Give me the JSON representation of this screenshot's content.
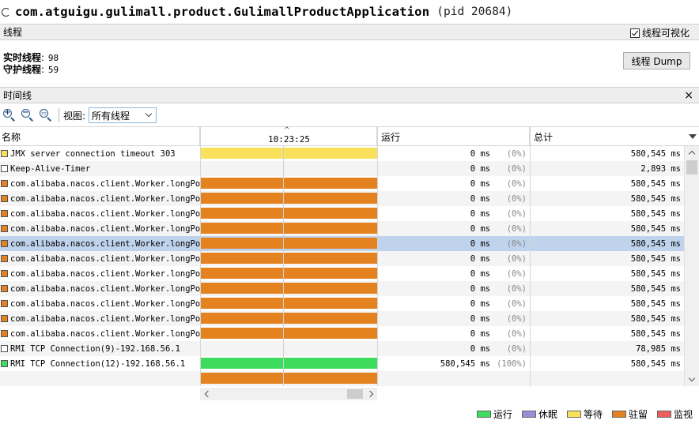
{
  "app": {
    "title": "com.atguigu.gulimall.product.GulimallProductApplication",
    "pid": "(pid 20684)"
  },
  "threads_panel": {
    "header": "线程",
    "visualize_label": "线程可视化",
    "visualize_checked": true,
    "live_label": "实时线程",
    "live_value": "98",
    "daemon_label": "守护线程",
    "daemon_value": "59",
    "dump_button": "线程 Dump"
  },
  "timeline_panel": {
    "header": "时间线",
    "close_symbol": "×",
    "view_label": "视图:",
    "view_selected": "所有线程",
    "zoom_in_symbol": "+",
    "zoom_out_symbol": "−"
  },
  "table": {
    "headers": {
      "name": "名称",
      "time": "10:23:25",
      "run": "运行",
      "total": "总计"
    },
    "rows": [
      {
        "color": "#fae15c",
        "name": "JMX server connection timeout 303",
        "bar": 1.0,
        "run": "0 ms",
        "pct": "(0%)",
        "total": "580,545 ms"
      },
      {
        "color": "#ffffff",
        "name": "Keep-Alive-Timer",
        "bar": 0,
        "run": "0 ms",
        "pct": "(0%)",
        "total": "2,893 ms"
      },
      {
        "color": "#e58220",
        "name": "com.alibaba.nacos.client.Worker.longPolling.fixed-",
        "bar": 1.0,
        "run": "0 ms",
        "pct": "(0%)",
        "total": "580,545 ms"
      },
      {
        "color": "#e58220",
        "name": "com.alibaba.nacos.client.Worker.longPolling.fixed-",
        "bar": 1.0,
        "run": "0 ms",
        "pct": "(0%)",
        "total": "580,545 ms"
      },
      {
        "color": "#e58220",
        "name": "com.alibaba.nacos.client.Worker.longPolling.fixed-",
        "bar": 1.0,
        "run": "0 ms",
        "pct": "(0%)",
        "total": "580,545 ms"
      },
      {
        "color": "#e58220",
        "name": "com.alibaba.nacos.client.Worker.longPolling.fixed-",
        "bar": 1.0,
        "run": "0 ms",
        "pct": "(0%)",
        "total": "580,545 ms"
      },
      {
        "color": "#e58220",
        "name": "com.alibaba.nacos.client.Worker.longPolling.fixed-",
        "bar": 1.0,
        "run": "0 ms",
        "pct": "(0%)",
        "total": "580,545 ms",
        "selected": true
      },
      {
        "color": "#e58220",
        "name": "com.alibaba.nacos.client.Worker.longPolling.fixed-",
        "bar": 1.0,
        "run": "0 ms",
        "pct": "(0%)",
        "total": "580,545 ms"
      },
      {
        "color": "#e58220",
        "name": "com.alibaba.nacos.client.Worker.longPolling.fixed-",
        "bar": 1.0,
        "run": "0 ms",
        "pct": "(0%)",
        "total": "580,545 ms"
      },
      {
        "color": "#e58220",
        "name": "com.alibaba.nacos.client.Worker.longPolling.fixed-",
        "bar": 1.0,
        "run": "0 ms",
        "pct": "(0%)",
        "total": "580,545 ms"
      },
      {
        "color": "#e58220",
        "name": "com.alibaba.nacos.client.Worker.longPolling.fixed-",
        "bar": 1.0,
        "run": "0 ms",
        "pct": "(0%)",
        "total": "580,545 ms"
      },
      {
        "color": "#e58220",
        "name": "com.alibaba.nacos.client.Worker.longPolling.fixed-",
        "bar": 1.0,
        "run": "0 ms",
        "pct": "(0%)",
        "total": "580,545 ms"
      },
      {
        "color": "#e58220",
        "name": "com.alibaba.nacos.client.Worker.longPolling.fixed-",
        "bar": 1.0,
        "run": "0 ms",
        "pct": "(0%)",
        "total": "580,545 ms"
      },
      {
        "color": "#ffffff",
        "name": "RMI TCP Connection(9)-192.168.56.1",
        "bar": 0,
        "run": "0 ms",
        "pct": "(0%)",
        "total": "78,985 ms"
      },
      {
        "color": "#3ddc5c",
        "name": "RMI TCP Connection(12)-192.168.56.1",
        "bar": 1.0,
        "run": "580,545 ms",
        "pct": "(100%)",
        "total": "580,545 ms"
      },
      {
        "color": "#e58220",
        "name": "",
        "bar": 1.0,
        "run": "",
        "pct": "",
        "total": ""
      }
    ]
  },
  "legend": [
    {
      "label": "运行",
      "color": "#3ddc5c"
    },
    {
      "label": "休眠",
      "color": "#9a8ed8"
    },
    {
      "label": "等待",
      "color": "#fae15c"
    },
    {
      "label": "驻留",
      "color": "#e58220"
    },
    {
      "label": "监视",
      "color": "#ee5d5d"
    }
  ]
}
